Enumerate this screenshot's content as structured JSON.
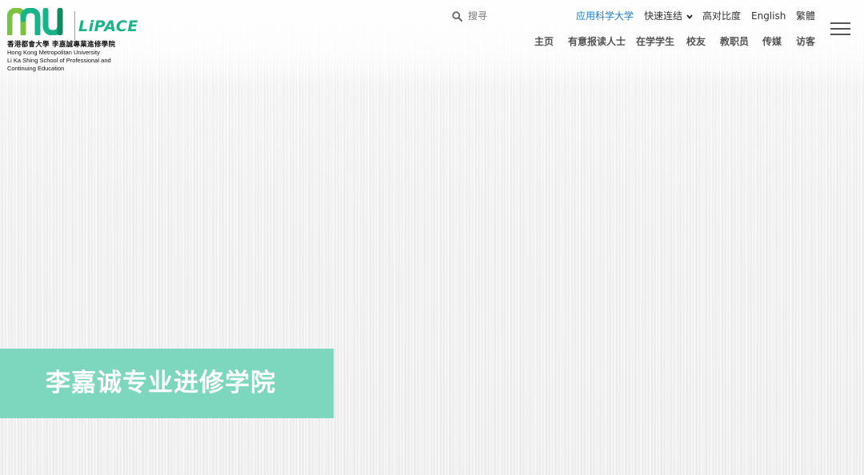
{
  "logo": {
    "brand_mark": "mu",
    "lipace": "LiPACE",
    "chinese_name": "香港都會大學 李嘉誠專業進修學院",
    "english_line1": "Hong Kong Metropolitan University",
    "english_line2": "Li Ka Shing School of Professional and",
    "english_line3": "Continuing Education",
    "colors": {
      "green": "#19b38a",
      "dark_green": "#0f8a63"
    }
  },
  "search": {
    "icon": "search-icon",
    "placeholder": "搜寻"
  },
  "utility_links": [
    {
      "label": "应用科学大学",
      "color": "#1a7fd0"
    },
    {
      "label": "快速连结",
      "icon": "chevron-down-icon"
    },
    {
      "label": "高对比度"
    },
    {
      "label": "English"
    },
    {
      "label": "繁體"
    }
  ],
  "main_nav": [
    {
      "label": "主页"
    },
    {
      "label": "有意报读人士"
    },
    {
      "label": "在学学生"
    },
    {
      "label": "校友"
    },
    {
      "label": "教职员"
    },
    {
      "label": "传媒"
    },
    {
      "label": "访客"
    }
  ],
  "menu_icon": "hamburger-menu-icon",
  "hero": {
    "title": "李嘉诚专业进修学院",
    "banner_color": "#7dd6be"
  }
}
